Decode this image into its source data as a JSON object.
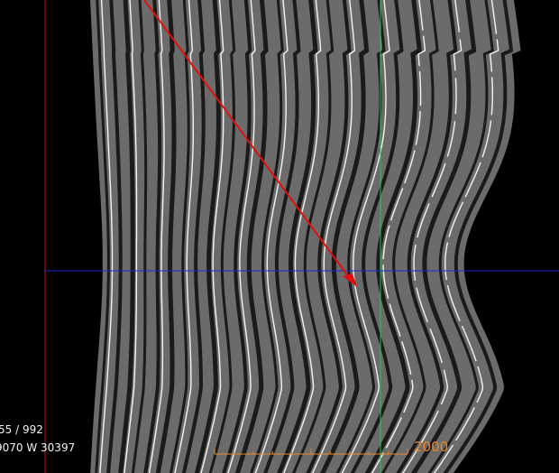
{
  "viewer": {
    "slice_readout": "55 / 992",
    "window_readout": "9070 W 30397",
    "scale_bar_label": "2000"
  },
  "colors": {
    "background": "#000000",
    "crosshair_vertical_left": "#c0141a",
    "crosshair_vertical_right": "#19d23c",
    "crosshair_horizontal": "#1d27d8",
    "annotation_arrow": "#e01010",
    "scale_bar": "#e88a2c",
    "overlay_text": "#f2f2f2"
  }
}
